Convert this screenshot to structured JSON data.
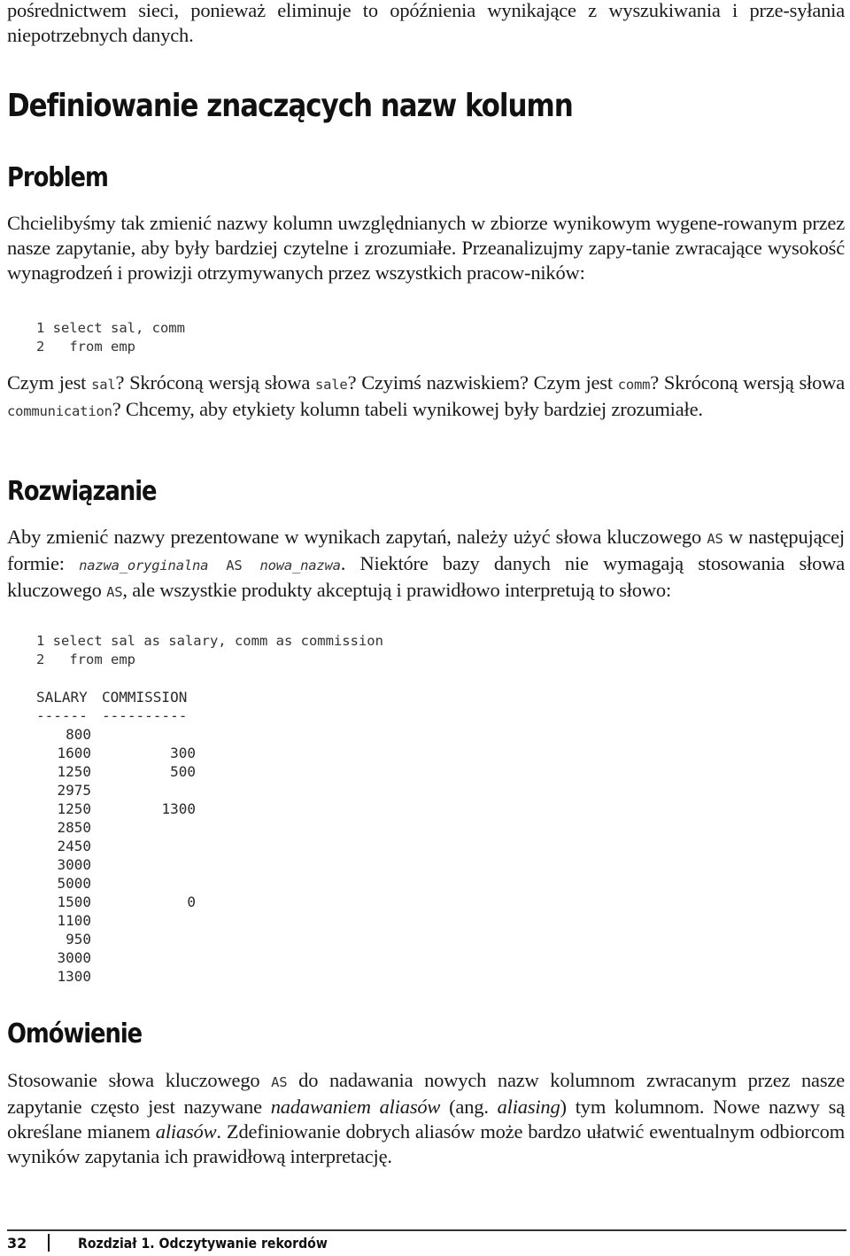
{
  "intro": {
    "text": "pośrednictwem sieci, ponieważ eliminuje to opóźnienia wynikające z wyszukiwania i prze-syłania niepotrzebnych danych."
  },
  "section_title": "Definiowanie znaczących nazw kolumn",
  "problem": {
    "heading": "Problem",
    "paragraph": "Chcielibyśmy tak zmienić nazwy kolumn uwzględnianych w zbiorze wynikowym wygene-rowanym przez nasze zapytanie, aby były bardziej czytelne i zrozumiałe. Przeanalizujmy zapy-tanie zwracające wysokość wynagrodzeń i prowizji otrzymywanych przez wszystkich pracow-ników:",
    "code": [
      "1 select sal, comm",
      "2   from emp"
    ],
    "question": {
      "t1": "Czym jest ",
      "c1": "sal",
      "t2": "? Skróconą wersją słowa ",
      "c2": "sale",
      "t3": "? Czyimś nazwiskiem? Czym jest ",
      "c3": "comm",
      "t4": "? Skróconą wersją słowa ",
      "c4": "communication",
      "t5": "? Chcemy, aby etykiety kolumn tabeli wynikowej były bardziej zrozumiałe."
    }
  },
  "solution": {
    "heading": "Rozwiązanie",
    "paragraph": {
      "t1": "Aby zmienić nazwy prezentowane w wynikach zapytań, należy użyć słowa kluczowego ",
      "c1": "AS",
      "t2": " w następującej formie: ",
      "c2a": "nazwa_oryginalna",
      "c2b": " AS ",
      "c2c": "nowa_nazwa",
      "t3": ". Niektóre bazy danych nie wymagają stosowania słowa kluczowego ",
      "c3": "AS",
      "t4": ", ale wszystkie produkty akceptują i prawidłowo interpretują to słowo:"
    },
    "code": [
      "1 select sal as salary, comm as commission",
      "2   from emp"
    ],
    "result_table": {
      "headers": [
        "SALARY",
        "COMMISSION"
      ],
      "separators": [
        "------",
        "----------"
      ],
      "rows": [
        [
          "800",
          ""
        ],
        [
          "1600",
          "300"
        ],
        [
          "1250",
          "500"
        ],
        [
          "2975",
          ""
        ],
        [
          "1250",
          "1300"
        ],
        [
          "2850",
          ""
        ],
        [
          "2450",
          ""
        ],
        [
          "3000",
          ""
        ],
        [
          "5000",
          ""
        ],
        [
          "1500",
          "0"
        ],
        [
          "1100",
          ""
        ],
        [
          "950",
          ""
        ],
        [
          "3000",
          ""
        ],
        [
          "1300",
          ""
        ]
      ]
    }
  },
  "discussion": {
    "heading": "Omówienie",
    "paragraph": {
      "t1": "Stosowanie słowa kluczowego ",
      "c1": "AS",
      "t2": " do nadawania nowych nazw kolumnom zwracanym przez nasze zapytanie często jest nazywane ",
      "i1": "nadawaniem aliasów",
      "t3": " (ang. ",
      "i2": "aliasing",
      "t4": ") tym kolumnom. Nowe nazwy są określane mianem ",
      "i3": "aliasów",
      "t5": ". Zdefiniowanie dobrych aliasów może bardzo ułatwić ewentualnym odbiorcom wyników zapytania ich prawidłową interpretację."
    }
  },
  "footer": {
    "page_number": "32",
    "chapter": "Rozdział 1. Odczytywanie rekordów"
  }
}
